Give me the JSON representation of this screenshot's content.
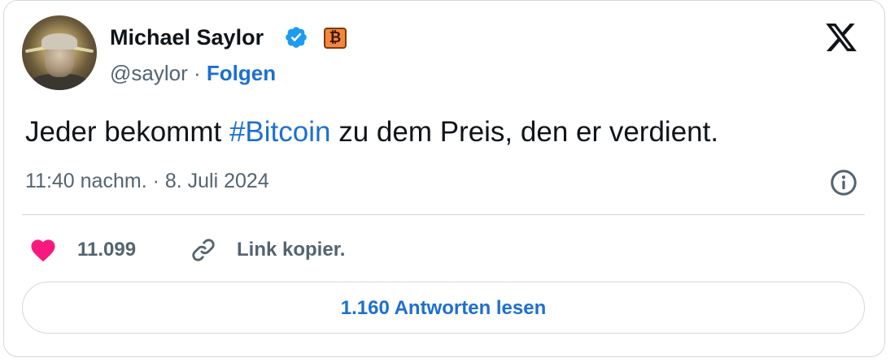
{
  "author": {
    "name": "Michael Saylor",
    "handle": "@saylor",
    "separator": "·",
    "follow_label": "Folgen",
    "verified_icon": "verified-badge-icon",
    "badge_icon": "bitcoin-b-icon",
    "badge_glyph": "₿",
    "avatar": "profile-photo"
  },
  "tweet": {
    "text_before": "Jeder bekommt ",
    "hashtag": "#Bitcoin",
    "text_after": " zu dem Preis, den er verdient.",
    "timestamp": "11:40 nachm. · 8. Juli 2024"
  },
  "actions": {
    "like_count": "11.099",
    "like_icon": "heart-icon",
    "link_label": "Link kopier.",
    "link_icon": "link-icon"
  },
  "replies_button": "1.160 Antworten lesen",
  "icons": {
    "logo": "x-logo-icon",
    "info": "info-icon"
  },
  "colors": {
    "accent": "#1d6fd1",
    "like": "#f91880",
    "verified": "#1d9bf0",
    "bitcoin_badge": "#f5863a",
    "muted_text": "#536471",
    "border": "#cfd9de"
  }
}
